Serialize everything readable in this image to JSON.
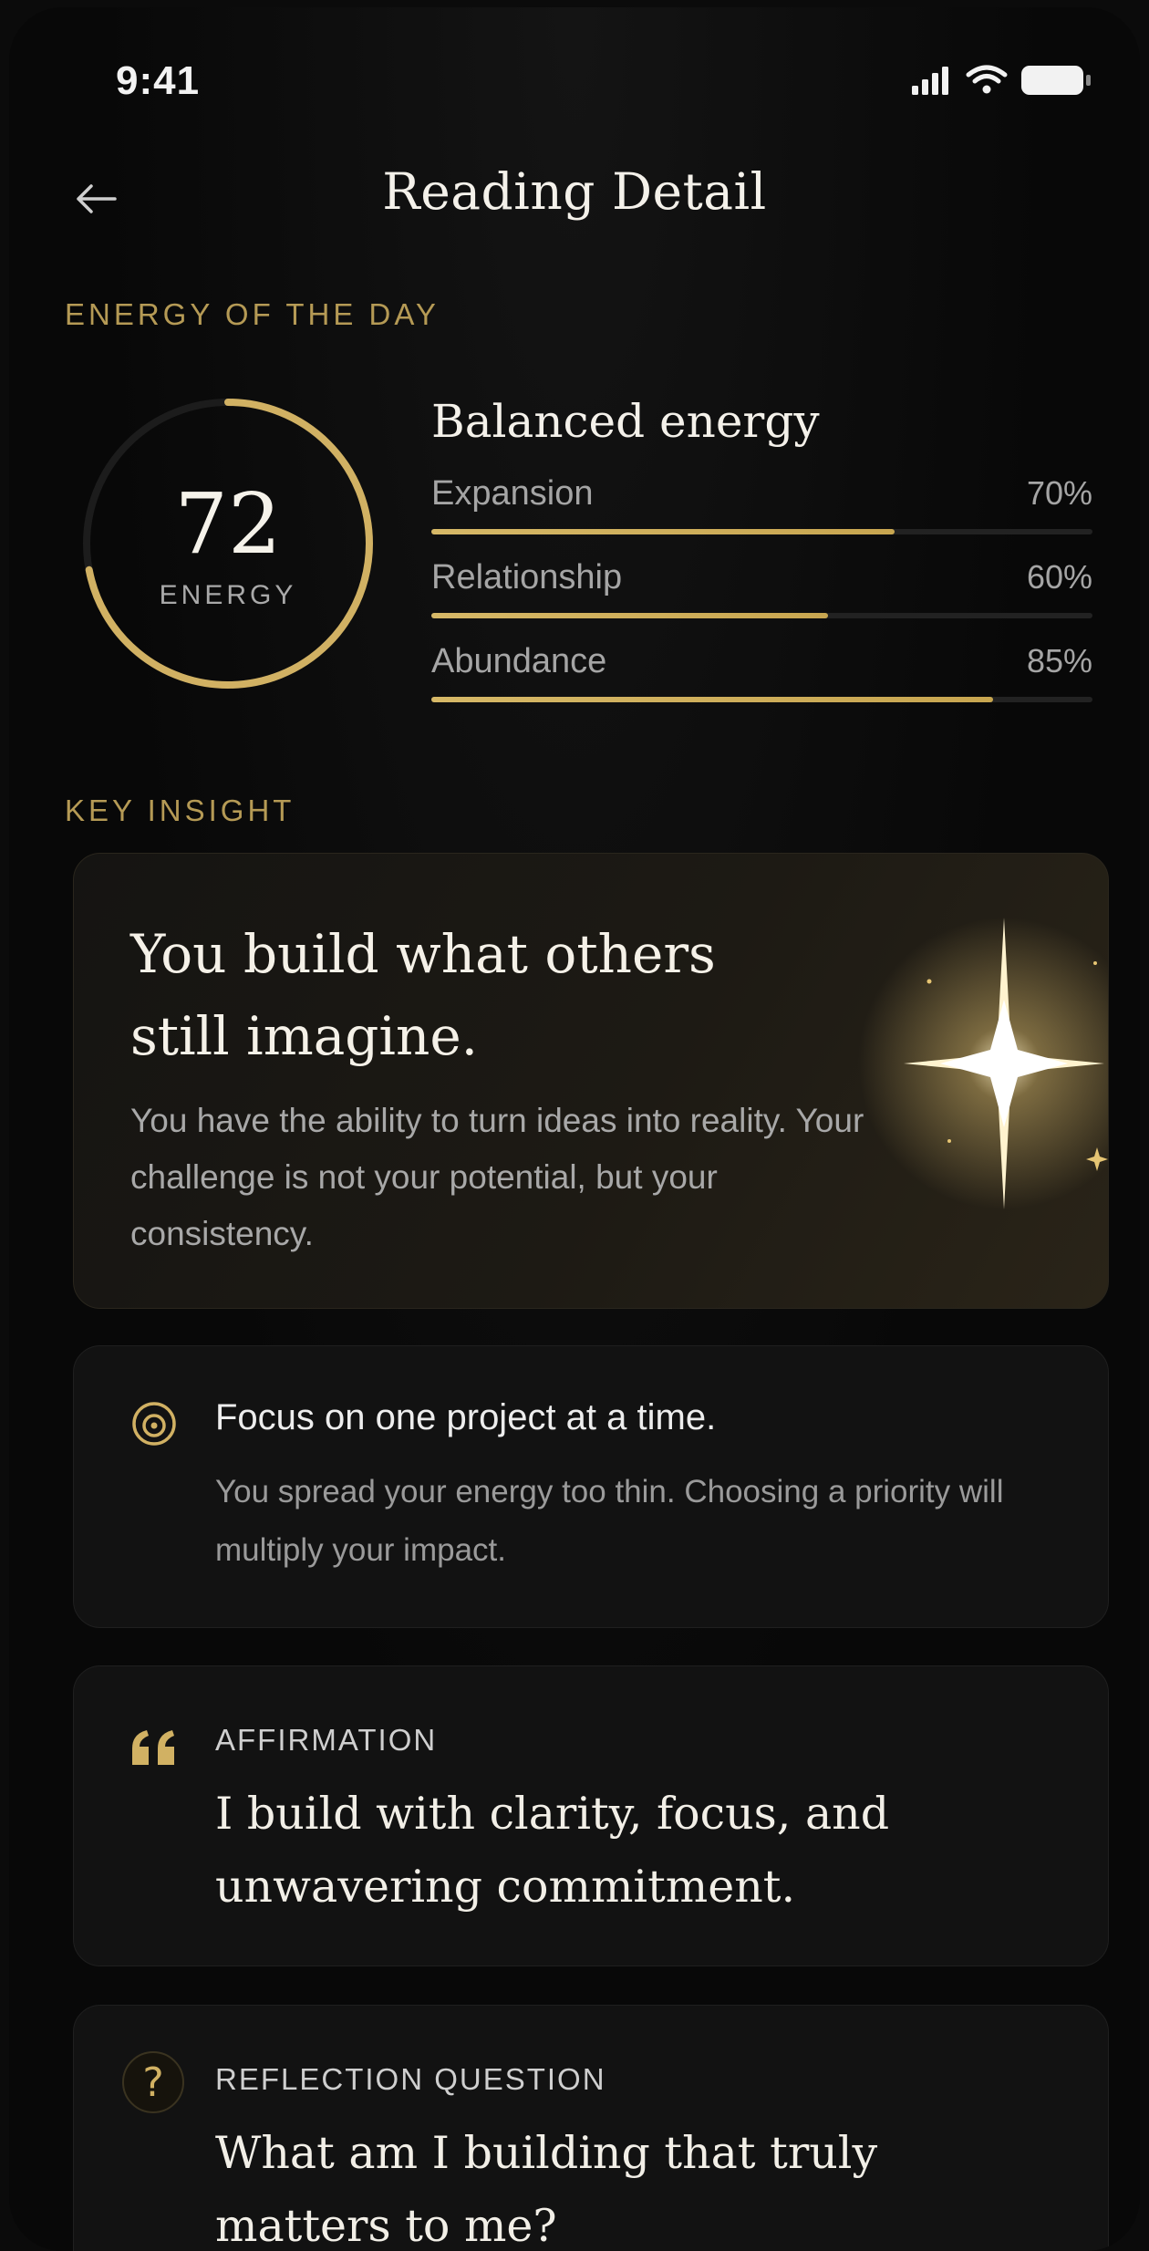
{
  "status_bar": {
    "time": "9:41"
  },
  "header": {
    "title": "Reading Detail"
  },
  "energy": {
    "section_label": "ENERGY OF THE DAY",
    "score": "72",
    "score_fraction": 0.72,
    "score_label": "ENERGY",
    "title": "Balanced energy",
    "metrics": [
      {
        "label": "Expansion",
        "percent_text": "70%",
        "value": 0.7
      },
      {
        "label": "Relationship",
        "percent_text": "60%",
        "value": 0.6
      },
      {
        "label": "Abundance",
        "percent_text": "85%",
        "value": 0.85
      }
    ]
  },
  "insight": {
    "section_label": "KEY INSIGHT",
    "headline_line1": "You build what others",
    "headline_line2": "still imagine.",
    "body": "You have the ability to turn ideas into reality. Your challenge is not your potential, but your consistency."
  },
  "focus": {
    "title": "Focus on one project at a time.",
    "body": "You spread your energy too thin. Choosing a priority will multiply your impact."
  },
  "affirmation": {
    "label": "AFFIRMATION",
    "text": "I build with clarity, focus, and unwavering commitment."
  },
  "reflection": {
    "label": "REFLECTION QUESTION",
    "text": "What am I building that truly matters to me?",
    "icon_glyph": "?"
  },
  "colors": {
    "accent": "#d1b163",
    "background": "#080808",
    "card": "#121212"
  }
}
